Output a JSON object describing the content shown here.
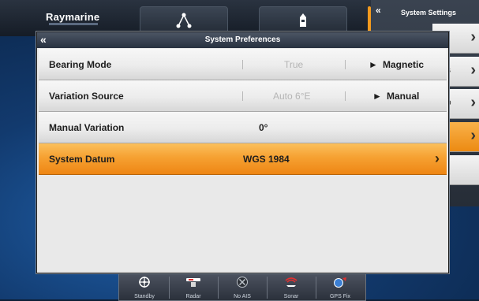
{
  "app": {
    "brand": "Raymarine"
  },
  "settings_panel": {
    "title": "System Settings",
    "items": [
      {
        "label": "",
        "selected": false
      },
      {
        "label": "s",
        "selected": false
      },
      {
        "label": "p",
        "selected": false
      },
      {
        "label": "",
        "selected": true
      },
      {
        "label": "",
        "selected": false
      }
    ]
  },
  "dialog": {
    "title": "System Preferences",
    "rows": [
      {
        "label": "Bearing Mode",
        "option_inactive": "True",
        "option_active": "Magnetic"
      },
      {
        "label": "Variation Source",
        "option_inactive": "Auto  6°E",
        "option_active": "Manual"
      },
      {
        "label": "Manual Variation",
        "value": "0°"
      },
      {
        "label": "System Datum",
        "value": "WGS 1984"
      }
    ]
  },
  "toolbar": {
    "items": [
      {
        "label": "Standby",
        "icon": "helm-icon"
      },
      {
        "label": "Radar",
        "icon": "radar-icon"
      },
      {
        "label": "No AIS",
        "icon": "ais-icon"
      },
      {
        "label": "Sonar",
        "icon": "sonar-icon"
      },
      {
        "label": "GPS Fix",
        "icon": "gps-icon"
      }
    ]
  },
  "colors": {
    "accent": "#f39a1e",
    "header": "#283140"
  }
}
